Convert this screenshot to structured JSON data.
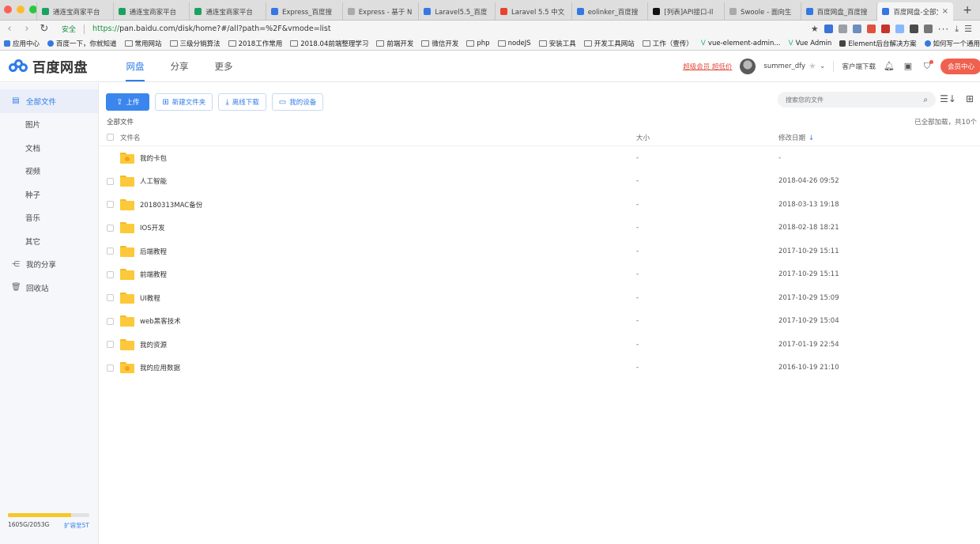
{
  "browser": {
    "tabs": [
      {
        "label": "通连宝商家平台",
        "color": "#1aa260",
        "active": false
      },
      {
        "label": "通连宝商家平台",
        "color": "#1aa260",
        "active": false
      },
      {
        "label": "通连宝商家平台",
        "color": "#1aa260",
        "active": false
      },
      {
        "label": "Express_百度搜",
        "color": "#3577e3",
        "active": false
      },
      {
        "label": "Express - 基于 N",
        "color": "#aaaaaa",
        "active": false
      },
      {
        "label": "Laravel5.5_百度",
        "color": "#3577e3",
        "active": false
      },
      {
        "label": "Laravel 5.5 中文",
        "color": "#e74430",
        "active": false
      },
      {
        "label": "eolinker_百度搜",
        "color": "#3577e3",
        "active": false
      },
      {
        "label": "[列表]API接口-Il",
        "color": "#111111",
        "active": false
      },
      {
        "label": "Swoole - 面向生",
        "color": "#aaaaaa",
        "active": false
      },
      {
        "label": "百度网盘_百度搜",
        "color": "#3577e3",
        "active": false
      },
      {
        "label": "百度网盘-全部文",
        "color": "#3577e3",
        "active": true
      }
    ],
    "security_label": "安全",
    "url_scheme": "https://",
    "url_rest": "pan.baidu.com/disk/home?#/all?path=%2F&vmode=list",
    "bookmarks": [
      {
        "label": "应用中心",
        "type": "apps"
      },
      {
        "label": "百度一下，你就知道",
        "type": "baidu"
      },
      {
        "label": "常用网站",
        "type": "folder"
      },
      {
        "label": "三级分销算法",
        "type": "folder"
      },
      {
        "label": "2018工作常用",
        "type": "folder"
      },
      {
        "label": "2018.04前端整理学习",
        "type": "folder"
      },
      {
        "label": "前端开发",
        "type": "folder"
      },
      {
        "label": "微信开发",
        "type": "folder"
      },
      {
        "label": "php",
        "type": "folder"
      },
      {
        "label": "nodeJS",
        "type": "folder"
      },
      {
        "label": "安装工具",
        "type": "folder"
      },
      {
        "label": "开发工具网站",
        "type": "folder"
      },
      {
        "label": "工作（壹传）",
        "type": "folder"
      },
      {
        "label": "vue-element-admin...",
        "type": "vue"
      },
      {
        "label": "Vue Admin",
        "type": "vue"
      },
      {
        "label": "Element后台解决方案",
        "type": "element"
      },
      {
        "label": "如何写一个通用的RE...",
        "type": "baidu"
      }
    ]
  },
  "header": {
    "logo_text": "百度网盘",
    "nav": [
      {
        "label": "网盘",
        "active": true
      },
      {
        "label": "分享",
        "active": false
      },
      {
        "label": "更多",
        "active": false
      }
    ],
    "vip_label": "超级会员 超低价",
    "username": "summer_dfy",
    "client_download": "客户端下载",
    "member_center": "会员中心"
  },
  "sidebar": {
    "items": [
      {
        "label": "全部文件",
        "icon": "files-icon",
        "glyph": "▤",
        "active": true,
        "sub": false
      },
      {
        "label": "图片",
        "sub": true
      },
      {
        "label": "文档",
        "sub": true
      },
      {
        "label": "视频",
        "sub": true
      },
      {
        "label": "种子",
        "sub": true
      },
      {
        "label": "音乐",
        "sub": true
      },
      {
        "label": "其它",
        "sub": true
      },
      {
        "label": "我的分享",
        "icon": "share-icon",
        "glyph": "⋲",
        "active": false,
        "sub": false
      },
      {
        "label": "回收站",
        "icon": "trash-icon",
        "glyph": "🗑",
        "active": false,
        "sub": false
      }
    ],
    "quota": {
      "used_text": "1605G/2053G",
      "expand_label": "扩容至5T",
      "used_fraction": 0.78
    }
  },
  "toolbar": {
    "upload": "上传",
    "new_folder": "新建文件夹",
    "offline_download": "离线下载",
    "my_devices": "我的设备",
    "search_placeholder": "搜索您的文件"
  },
  "listing": {
    "breadcrumb": "全部文件",
    "loaded_text": "已全部加载，共10个",
    "columns": {
      "name": "文件名",
      "size": "大小",
      "date": "修改日期"
    },
    "rows": [
      {
        "name": "我的卡包",
        "size": "-",
        "date": "-",
        "special": true
      },
      {
        "name": "人工智能",
        "size": "-",
        "date": "2018-04-26 09:52",
        "special": false
      },
      {
        "name": "20180313MAC备份",
        "size": "-",
        "date": "2018-03-13 19:18",
        "special": false
      },
      {
        "name": "IOS开发",
        "size": "-",
        "date": "2018-02-18 18:21",
        "special": false
      },
      {
        "name": "后端教程",
        "size": "-",
        "date": "2017-10-29 15:11",
        "special": false
      },
      {
        "name": "前端教程",
        "size": "-",
        "date": "2017-10-29 15:11",
        "special": false
      },
      {
        "name": "UI教程",
        "size": "-",
        "date": "2017-10-29 15:09",
        "special": false
      },
      {
        "name": "web黑客技术",
        "size": "-",
        "date": "2017-10-29 15:04",
        "special": false
      },
      {
        "name": "我的资源",
        "size": "-",
        "date": "2017-01-19 22:54",
        "special": false
      },
      {
        "name": "我的应用数据",
        "size": "-",
        "date": "2016-10-19 21:10",
        "special": true
      }
    ]
  },
  "colors": {
    "accent": "#2f7ce8",
    "vip": "#e54b3c",
    "folder": "#fcc93a",
    "quota": "#f8c728"
  }
}
